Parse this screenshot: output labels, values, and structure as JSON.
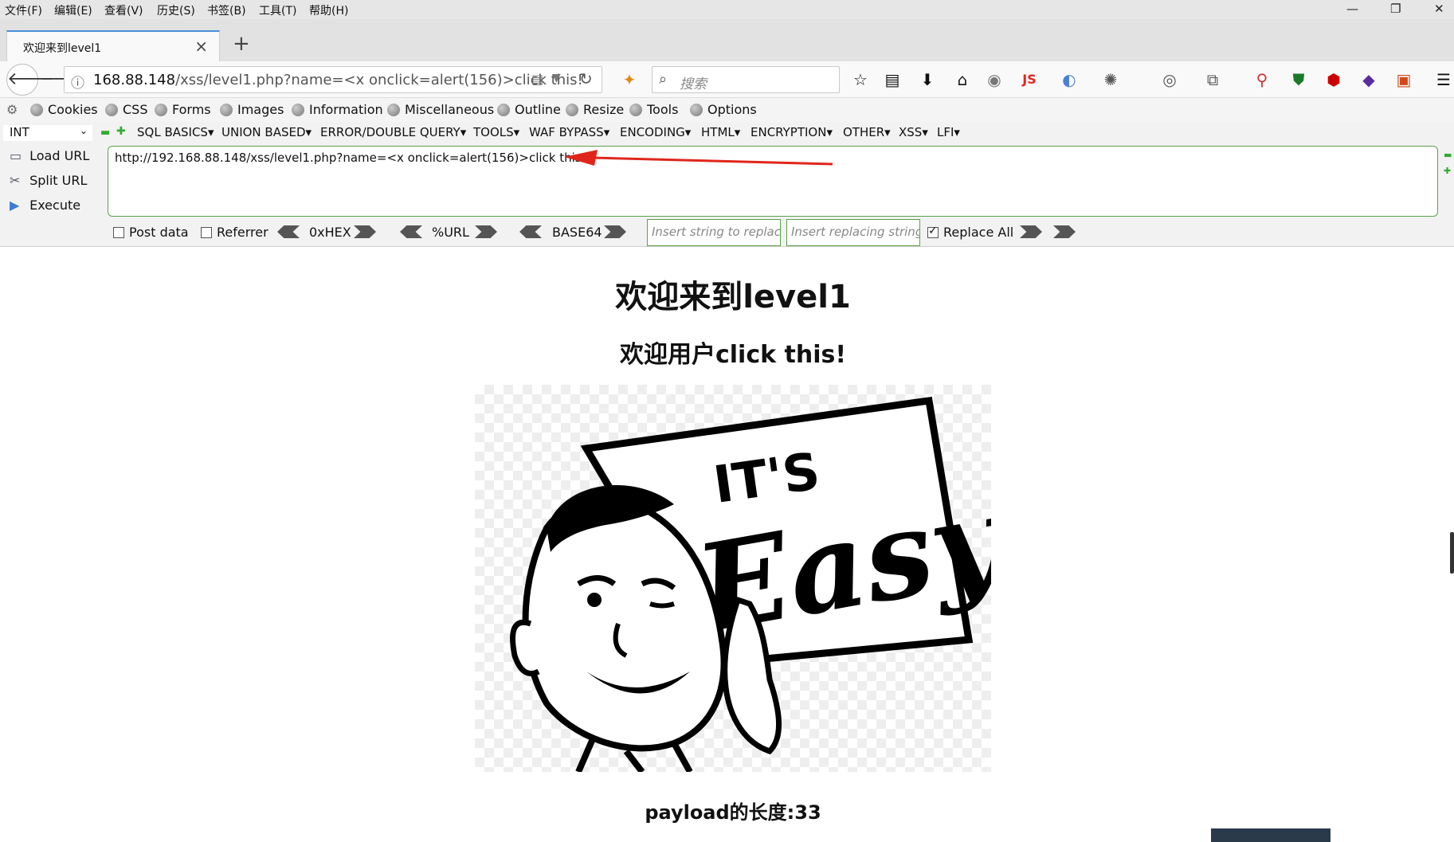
{
  "menubar": {
    "items": [
      "文件(F)",
      "编辑(E)",
      "查看(V)",
      "历史(S)",
      "书签(B)",
      "工具(T)",
      "帮助(H)"
    ]
  },
  "tab": {
    "title": "欢迎来到level1"
  },
  "urlbar": {
    "host": "168.88.148",
    "path": "/xss/level1.php?name=<x onclick=alert(156)>click this!"
  },
  "search": {
    "placeholder": "搜索"
  },
  "bookmarks": [
    "Cookies",
    "CSS",
    "Forms",
    "Images",
    "Information",
    "Miscellaneous",
    "Outline",
    "Resize",
    "Tools",
    "Options"
  ],
  "hackbar": {
    "type_select": "INT",
    "menus": [
      "SQL BASICS",
      "UNION BASED",
      "ERROR/DOUBLE QUERY",
      "TOOLS",
      "WAF BYPASS",
      "ENCODING",
      "HTML",
      "ENCRYPTION",
      "OTHER",
      "XSS",
      "LFI"
    ],
    "actions": [
      "Load URL",
      "Split URL",
      "Execute"
    ],
    "url_value": "http://192.168.88.148/xss/level1.php?name=<x onclick=alert(156)>click this!",
    "post_data_label": "Post data",
    "referrer_label": "Referrer",
    "encoders": [
      "0xHEX",
      "%URL",
      "BASE64"
    ],
    "replace_placeholder": "Insert string to replace",
    "replacing_placeholder": "Insert replacing string",
    "replace_all_label": "Replace All",
    "replace_all_checked": true
  },
  "page": {
    "heading": "欢迎来到level1",
    "subheading": "欢迎用户click this!",
    "image_text": "IT'S Easy",
    "payload_length": "payload的长度:33"
  },
  "colors": {
    "arrow": "#e0261c",
    "hackbar_border": "#5ca14a",
    "js_badge": "#e0261c"
  }
}
